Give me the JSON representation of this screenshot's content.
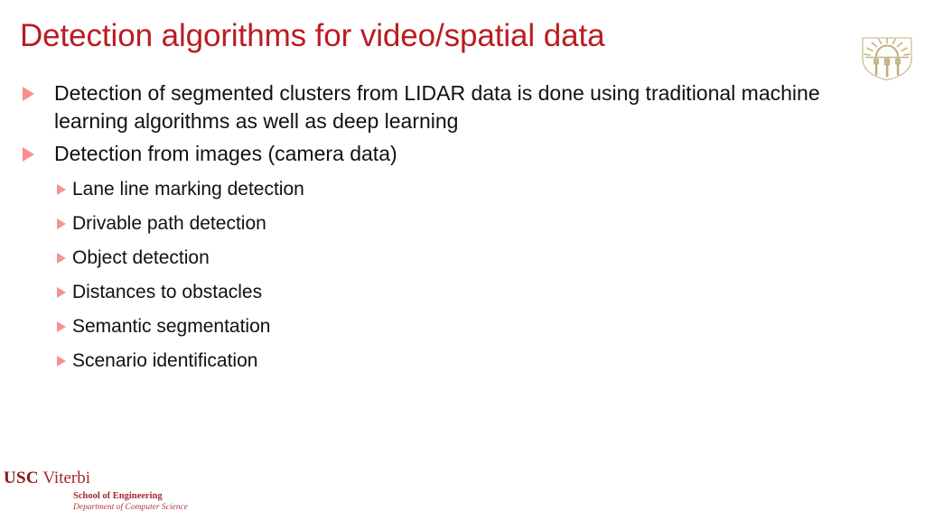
{
  "slide": {
    "title": "Detection algorithms for video/spatial data",
    "title_color": "#B91C22",
    "background_color": "#ffffff",
    "bullet_marker_color": "#F89090"
  },
  "crest": {
    "name": "usc-shield-crest",
    "color": "#C9BC8E"
  },
  "body": {
    "bullets": [
      {
        "level": 1,
        "text": "Detection of segmented clusters from LIDAR data is done using traditional machine learning algorithms as well as deep learning"
      },
      {
        "level": 1,
        "text": "Detection from images (camera data)"
      }
    ],
    "sub_bullets": [
      {
        "level": 2,
        "text": "Lane line marking detection"
      },
      {
        "level": 2,
        "text": "Drivable path detection"
      },
      {
        "level": 2,
        "text": "Object detection"
      },
      {
        "level": 2,
        "text": "Distances to obstacles"
      },
      {
        "level": 2,
        "text": "Semantic segmentation"
      },
      {
        "level": 2,
        "text": "Scenario identification"
      }
    ]
  },
  "footer": {
    "brand_primary": "USC",
    "brand_secondary": "Viterbi",
    "school": "School of Engineering",
    "department": "Department of Computer Science",
    "brand_color": "#9E1B20"
  }
}
